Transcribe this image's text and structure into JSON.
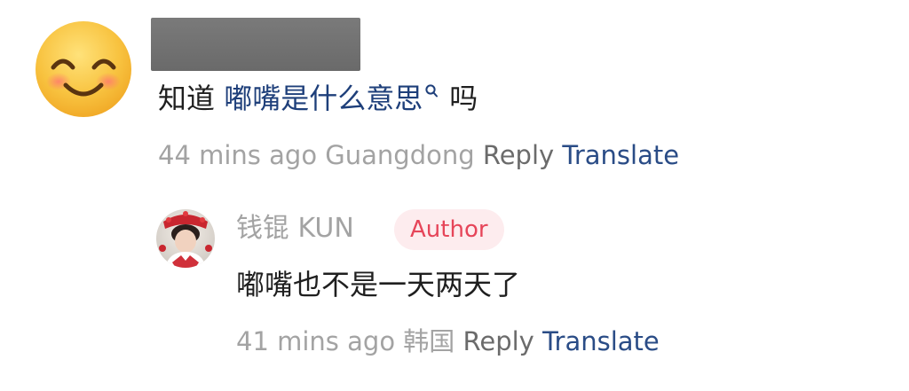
{
  "comment": {
    "avatar_icon": "smiling-face-emoji",
    "text_prefix": "知道 ",
    "link_text": "嘟嘴是什么意思",
    "search_icon": "search-mini-icon",
    "text_suffix": "吗",
    "time": "44 mins ago",
    "location": "Guangdong",
    "reply_label": "Reply",
    "translate_label": "Translate"
  },
  "reply": {
    "username": "钱锟 KUN",
    "badge": "Author",
    "text": "嘟嘴也不是一天两天了",
    "time": "41 mins ago",
    "location": "韩国",
    "reply_label": "Reply",
    "translate_label": "Translate"
  },
  "colors": {
    "link": "#1e3f7a",
    "translate": "#2a4c86",
    "badge_text": "#e64559",
    "badge_bg": "#fdecee",
    "meta_gray": "#a3a3a3"
  }
}
